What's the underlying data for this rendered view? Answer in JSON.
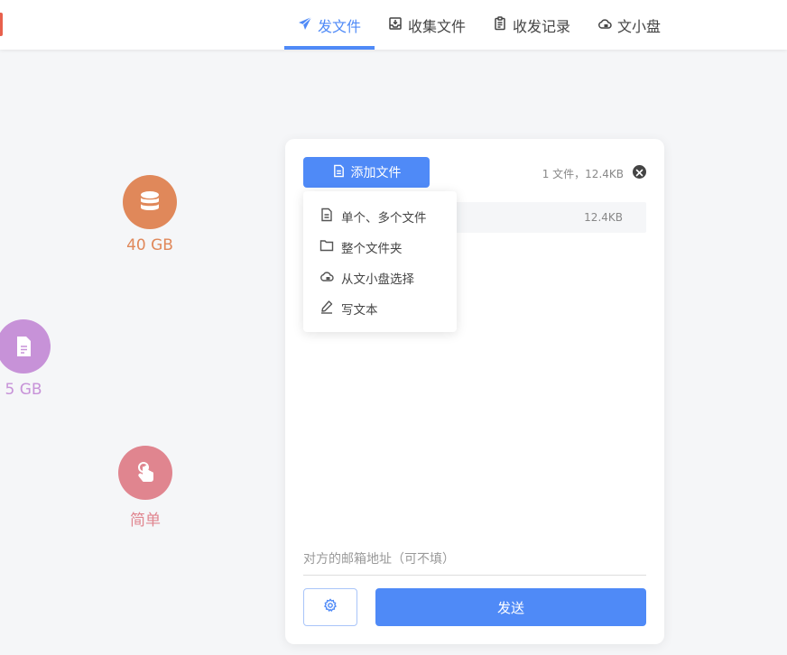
{
  "nav": {
    "tabs": [
      {
        "label": "发文件",
        "icon": "send-icon",
        "active": true
      },
      {
        "label": "收集文件",
        "icon": "inbox-icon",
        "active": false
      },
      {
        "label": "收发记录",
        "icon": "clipboard-icon",
        "active": false
      },
      {
        "label": "文小盘",
        "icon": "cloud-icon",
        "active": false
      }
    ]
  },
  "features": [
    {
      "caption": "40 GB",
      "icon": "database-icon",
      "color": "#e0885a",
      "text_color": "#e0885a"
    },
    {
      "caption": "5 GB",
      "icon": "file-icon",
      "color": "#c792d8",
      "text_color": "#c792d8"
    },
    {
      "caption": "简单",
      "icon": "pointer-hand-icon",
      "color": "#e0858f",
      "text_color": "#e0858f"
    }
  ],
  "card": {
    "add_button_label": "添加文件",
    "summary": "1 文件，12.4KB",
    "file_size": "12.4KB",
    "email_placeholder": "对方的邮箱地址（可不填）",
    "send_label": "发送"
  },
  "dropdown": {
    "items": [
      {
        "label": "单个、多个文件",
        "icon": "file-icon"
      },
      {
        "label": "整个文件夹",
        "icon": "folder-icon"
      },
      {
        "label": "从文小盘选择",
        "icon": "cloud-icon"
      },
      {
        "label": "写文本",
        "icon": "pen-icon"
      }
    ]
  },
  "colors": {
    "accent": "#4f8af7",
    "brand": "#e8604c"
  }
}
